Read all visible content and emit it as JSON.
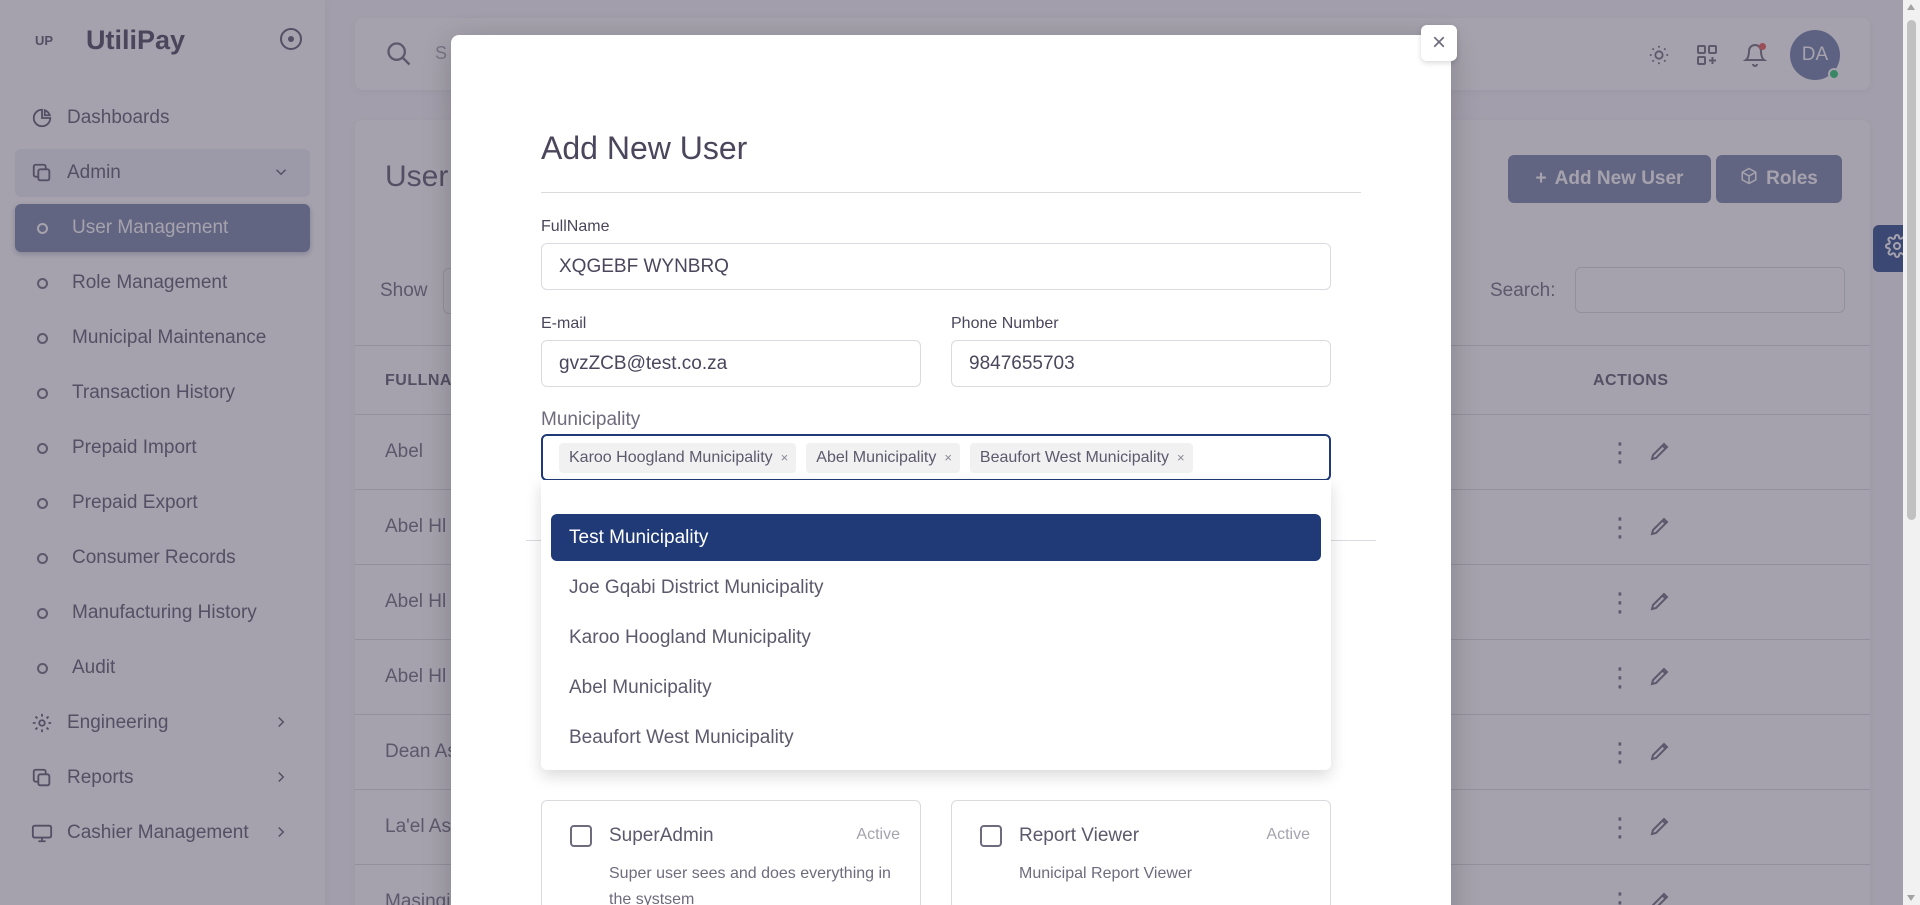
{
  "app": {
    "brand": "UtiliPay",
    "logo_text": "UP"
  },
  "sidebar": {
    "items": [
      {
        "label": "Dashboards",
        "icon": "pie-chart-icon"
      },
      {
        "label": "Admin",
        "icon": "copy-icon"
      },
      {
        "label": "User Management"
      },
      {
        "label": "Role Management"
      },
      {
        "label": "Municipal Maintenance"
      },
      {
        "label": "Transaction History"
      },
      {
        "label": "Prepaid Import"
      },
      {
        "label": "Prepaid Export"
      },
      {
        "label": "Consumer Records"
      },
      {
        "label": "Manufacturing History"
      },
      {
        "label": "Audit"
      },
      {
        "label": "Engineering",
        "icon": "gear-icon"
      },
      {
        "label": "Reports",
        "icon": "copy-icon"
      },
      {
        "label": "Cashier Management",
        "icon": "monitor-icon"
      }
    ]
  },
  "navbar": {
    "search_placeholder": "S",
    "avatar_initials": "DA"
  },
  "page": {
    "title": "User",
    "add_user_label": "Add New User",
    "roles_label": "Roles",
    "show_label": "Show",
    "search_label": "Search:",
    "columns": {
      "fullname": "FULLNA",
      "actions": "ACTIONS"
    },
    "rows": [
      "Abel",
      "Abel Hl",
      "Abel Hl",
      "Abel Hl",
      "Dean As",
      "La'el As",
      "Masingi"
    ]
  },
  "modal": {
    "title": "Add New User",
    "fullname_label": "FullName",
    "fullname_value": "XQGEBF WYNBRQ",
    "email_label": "E-mail",
    "email_value": "gvzZCB@test.co.za",
    "phone_label": "Phone Number",
    "phone_value": "9847655703",
    "municipality_label": "Municipality",
    "selected_tags": [
      "Karoo Hoogland Municipality",
      "Abel Municipality",
      "Beaufort West Municipality"
    ],
    "tag_remove": "×",
    "options": [
      "Test Municipality",
      "Joe Gqabi District Municipality",
      "Karoo Hoogland Municipality",
      "Abel Municipality",
      "Beaufort West Municipality"
    ],
    "close_label": "×",
    "roles": [
      {
        "name": "SuperAdmin",
        "status": "Active",
        "description": "Super user sees and does everything in the systsem"
      },
      {
        "name": "Report Viewer",
        "status": "Active",
        "description": "Municipal Report Viewer"
      }
    ]
  },
  "colors": {
    "primary": "#7684a8",
    "selected_option": "#1f3a77",
    "settings_tab": "#2a4a8a"
  }
}
